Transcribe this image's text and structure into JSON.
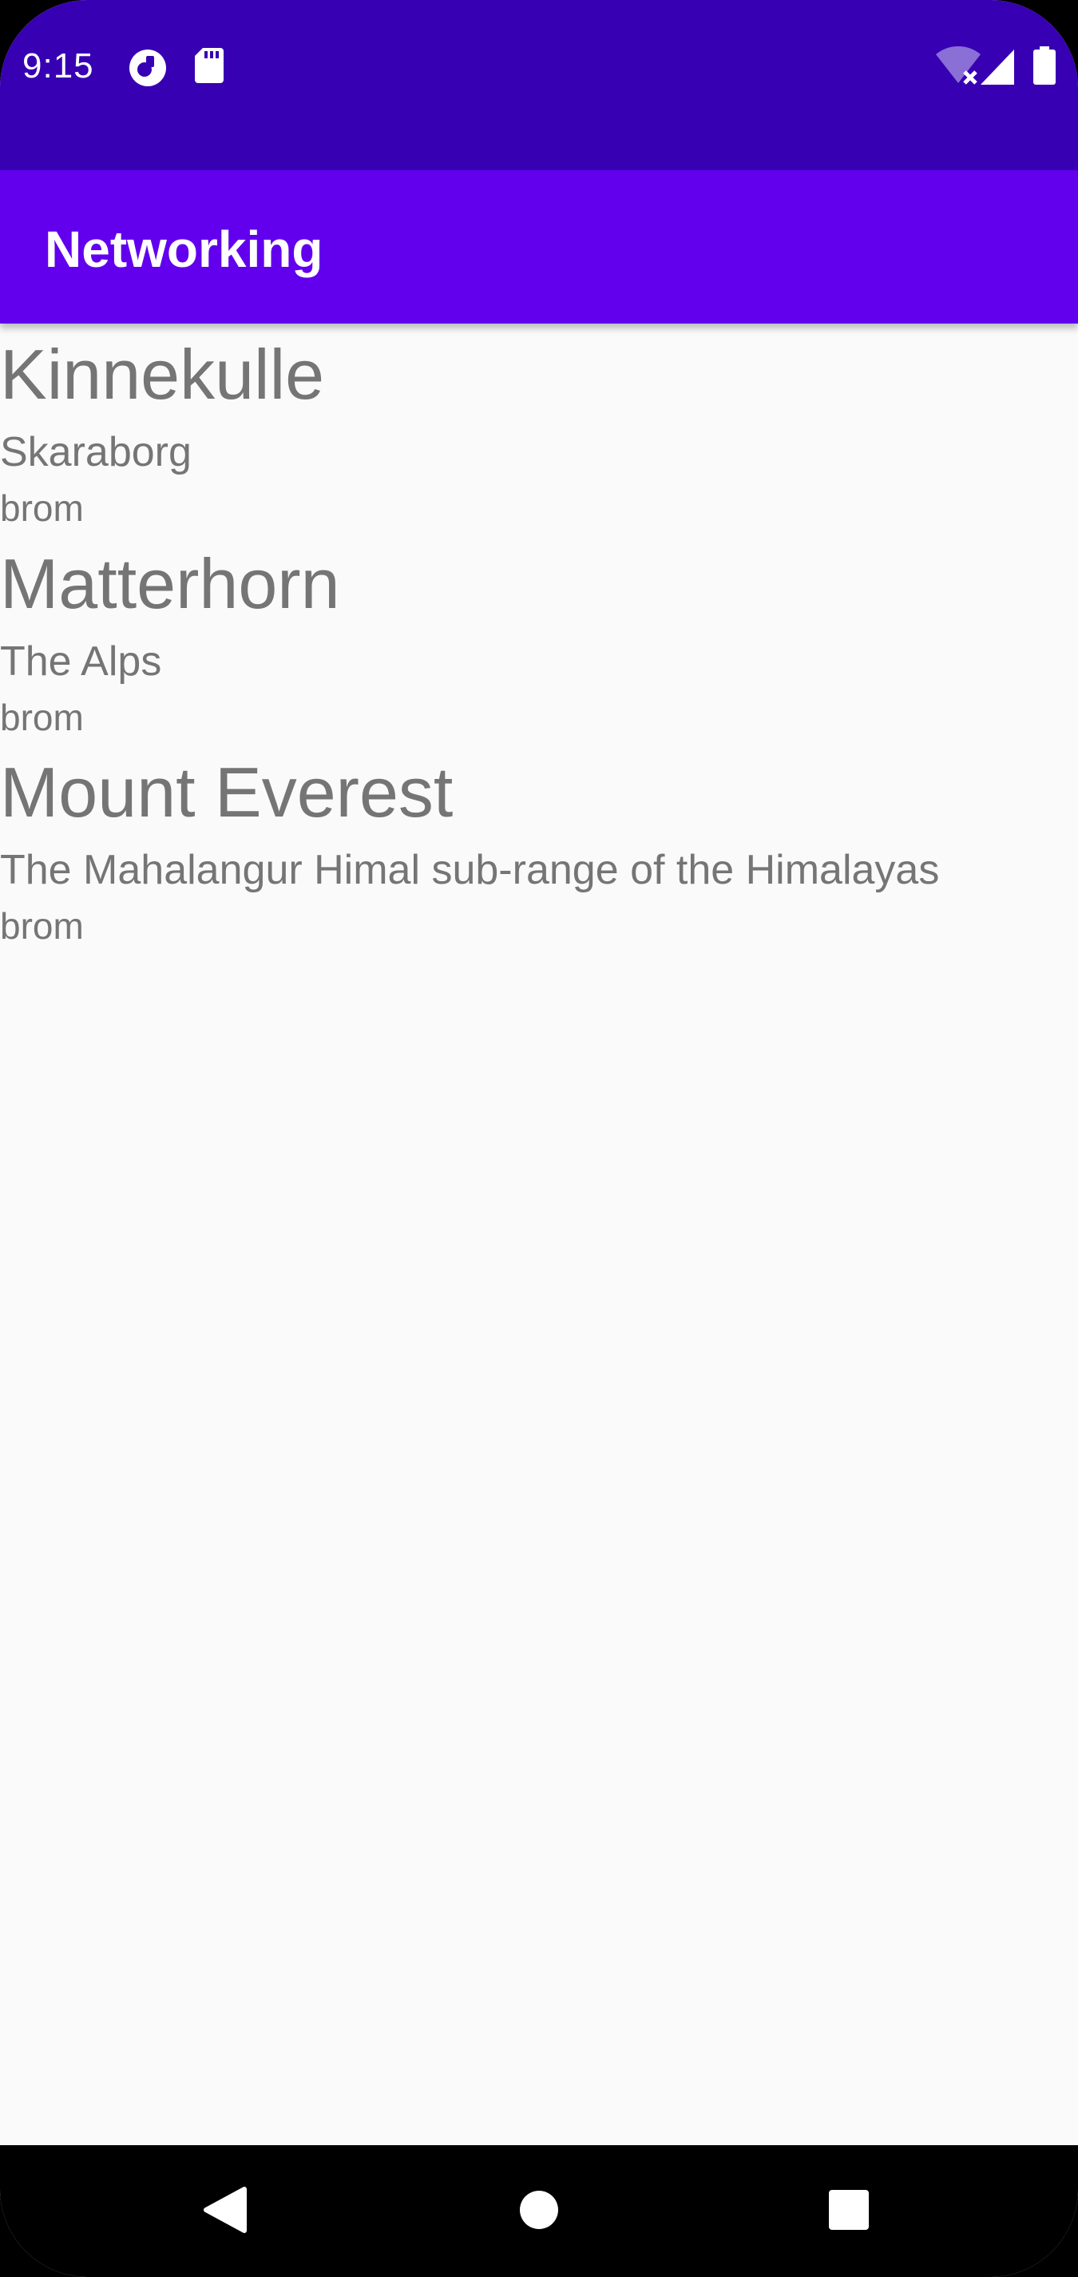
{
  "status_bar": {
    "time": "9:15",
    "icons": [
      "privacy-indicator-icon",
      "sd-card-icon",
      "wifi-no-internet-icon",
      "cell-signal-icon",
      "battery-icon"
    ],
    "background": "#3700b3"
  },
  "app_bar": {
    "title": "Networking",
    "background": "#6200ee"
  },
  "mountains": [
    {
      "name": "Kinnekulle",
      "location": "Skaraborg",
      "type": "brom"
    },
    {
      "name": "Matterhorn",
      "location": "The Alps",
      "type": "brom"
    },
    {
      "name": "Mount Everest",
      "location": "The Mahalangur Himal sub-range of the Himalayas",
      "type": "brom"
    }
  ],
  "nav_bar": {
    "buttons": [
      "back-icon",
      "home-icon",
      "recents-icon"
    ]
  }
}
